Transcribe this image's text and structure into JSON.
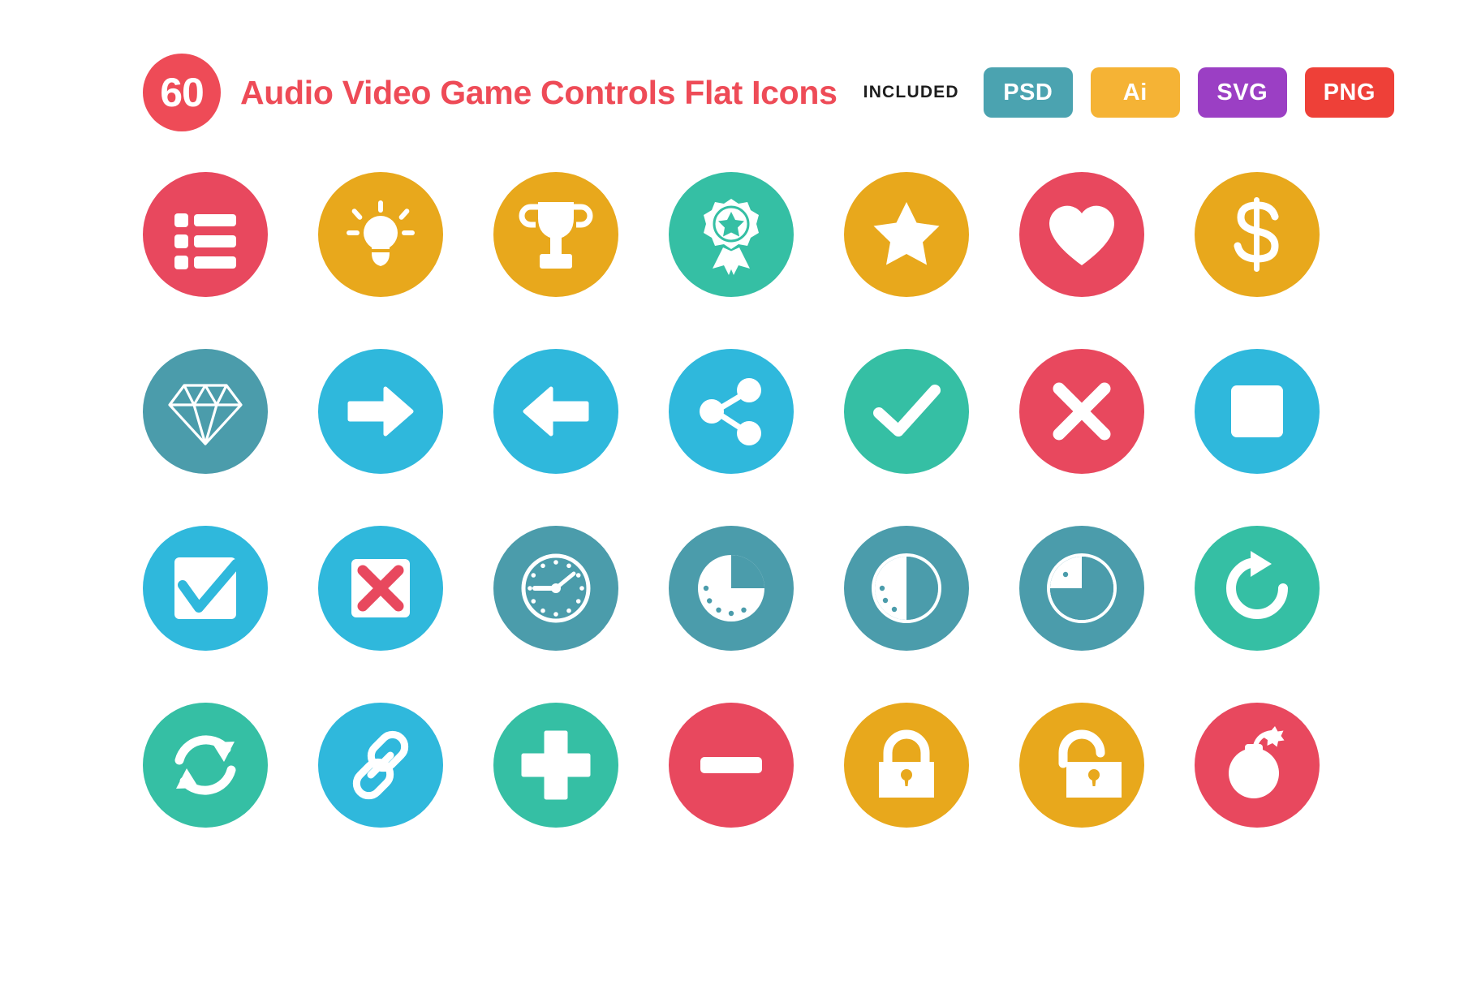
{
  "header": {
    "count": "60",
    "title": "Audio Video Game Controls Flat Icons",
    "included_label": "INCLUDED",
    "formats": [
      {
        "label": "PSD",
        "color": "#4BA3B0"
      },
      {
        "label": "Ai",
        "color": "#F5B335"
      },
      {
        "label": "SVG",
        "color": "#9B3FC4"
      },
      {
        "label": "PNG",
        "color": "#EE4038"
      }
    ],
    "count_badge_color": "#EE4B57",
    "title_color": "#EE4B57"
  },
  "palette": {
    "red": "#E8485E",
    "amber": "#E8A81C",
    "teal": "#35BFA4",
    "steel": "#4B9CAB",
    "cyan": "#2FB8DC",
    "white": "#FFFFFF"
  },
  "grid": {
    "columns": 7,
    "rows": 4,
    "icons": [
      {
        "name": "list-icon",
        "label": "List",
        "bg": "#E8485E"
      },
      {
        "name": "lightbulb-icon",
        "label": "Lightbulb",
        "bg": "#E8A81C"
      },
      {
        "name": "trophy-icon",
        "label": "Trophy",
        "bg": "#E8A81C"
      },
      {
        "name": "award-ribbon-icon",
        "label": "Award Ribbon",
        "bg": "#35BFA4"
      },
      {
        "name": "star-icon",
        "label": "Star",
        "bg": "#E8A81C"
      },
      {
        "name": "heart-icon",
        "label": "Heart",
        "bg": "#E8485E"
      },
      {
        "name": "dollar-icon",
        "label": "Dollar",
        "bg": "#E8A81C"
      },
      {
        "name": "diamond-icon",
        "label": "Diamond",
        "bg": "#4B9CAB"
      },
      {
        "name": "arrow-right-icon",
        "label": "Arrow Right",
        "bg": "#2FB8DC"
      },
      {
        "name": "arrow-left-icon",
        "label": "Arrow Left",
        "bg": "#2FB8DC"
      },
      {
        "name": "share-icon",
        "label": "Share",
        "bg": "#2FB8DC"
      },
      {
        "name": "check-icon",
        "label": "Check",
        "bg": "#35BFA4"
      },
      {
        "name": "close-x-icon",
        "label": "Close",
        "bg": "#E8485E"
      },
      {
        "name": "stop-square-icon",
        "label": "Stop",
        "bg": "#2FB8DC"
      },
      {
        "name": "checkbox-checked-icon",
        "label": "Checkbox Checked",
        "bg": "#2FB8DC"
      },
      {
        "name": "checkbox-x-icon",
        "label": "Checkbox Cross",
        "bg": "#2FB8DC"
      },
      {
        "name": "clock-icon",
        "label": "Clock",
        "bg": "#4B9CAB"
      },
      {
        "name": "clock-quarter-icon",
        "label": "Clock Quarter",
        "bg": "#4B9CAB"
      },
      {
        "name": "clock-half-icon",
        "label": "Clock Half",
        "bg": "#4B9CAB"
      },
      {
        "name": "clock-three-quarter-icon",
        "label": "Clock Three Quarter",
        "bg": "#4B9CAB"
      },
      {
        "name": "redo-icon",
        "label": "Redo",
        "bg": "#35BFA4"
      },
      {
        "name": "sync-icon",
        "label": "Sync",
        "bg": "#35BFA4"
      },
      {
        "name": "link-icon",
        "label": "Link",
        "bg": "#2FB8DC"
      },
      {
        "name": "plus-icon",
        "label": "Plus",
        "bg": "#35BFA4"
      },
      {
        "name": "minus-icon",
        "label": "Minus",
        "bg": "#E8485E"
      },
      {
        "name": "lock-closed-icon",
        "label": "Lock Closed",
        "bg": "#E8A81C"
      },
      {
        "name": "lock-open-icon",
        "label": "Lock Open",
        "bg": "#E8A81C"
      },
      {
        "name": "bomb-icon",
        "label": "Bomb",
        "bg": "#E8485E"
      }
    ]
  }
}
